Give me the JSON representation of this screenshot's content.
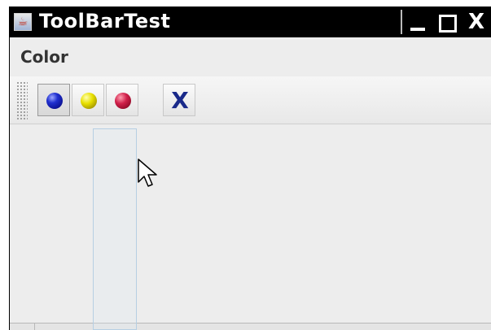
{
  "window": {
    "title": "ToolBarTest"
  },
  "menubar": {
    "items": [
      {
        "label": "Color"
      }
    ]
  },
  "toolbar": {
    "buttons": [
      {
        "name": "blue",
        "icon": "blue-ball-icon",
        "color": "#1f2fc8",
        "pressed": true
      },
      {
        "name": "yellow",
        "icon": "yellow-ball-icon",
        "color": "#e6de00"
      },
      {
        "name": "red",
        "icon": "red-ball-icon",
        "color": "#d0204a"
      },
      {
        "name": "exit",
        "icon": "close-x-icon",
        "label": "X",
        "color": "#1a2a8a"
      }
    ]
  },
  "window_controls": {
    "close_label": "X"
  },
  "colors": {
    "titlebar_bg": "#000000",
    "panel_bg": "#ededed",
    "drag_outline": "#b6cfe3"
  }
}
